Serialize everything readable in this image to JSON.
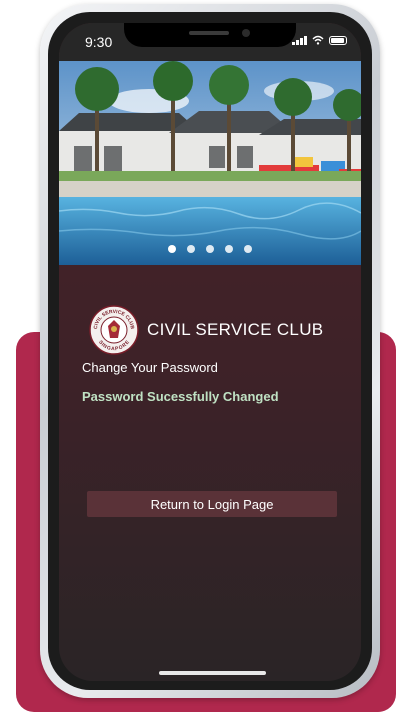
{
  "status_bar": {
    "time": "9:30"
  },
  "hero": {
    "icon": "resort-pool-photo",
    "slides": 5,
    "active_slide": 1
  },
  "brand": {
    "name": "CIVIL SERVICE CLUB",
    "logo_ring_top": "CIVIL SERVICE CLUB",
    "logo_ring_bottom": "SINGAPORE"
  },
  "page": {
    "subtitle": "Change Your Password",
    "success_message": "Password Sucessfully Changed",
    "return_button": "Return to Login Page"
  },
  "colors": {
    "accent_card": "#b0284d",
    "screen_bg": "#4a2329",
    "success_text": "#bfe1c3",
    "button_bg": "#5a3238"
  }
}
